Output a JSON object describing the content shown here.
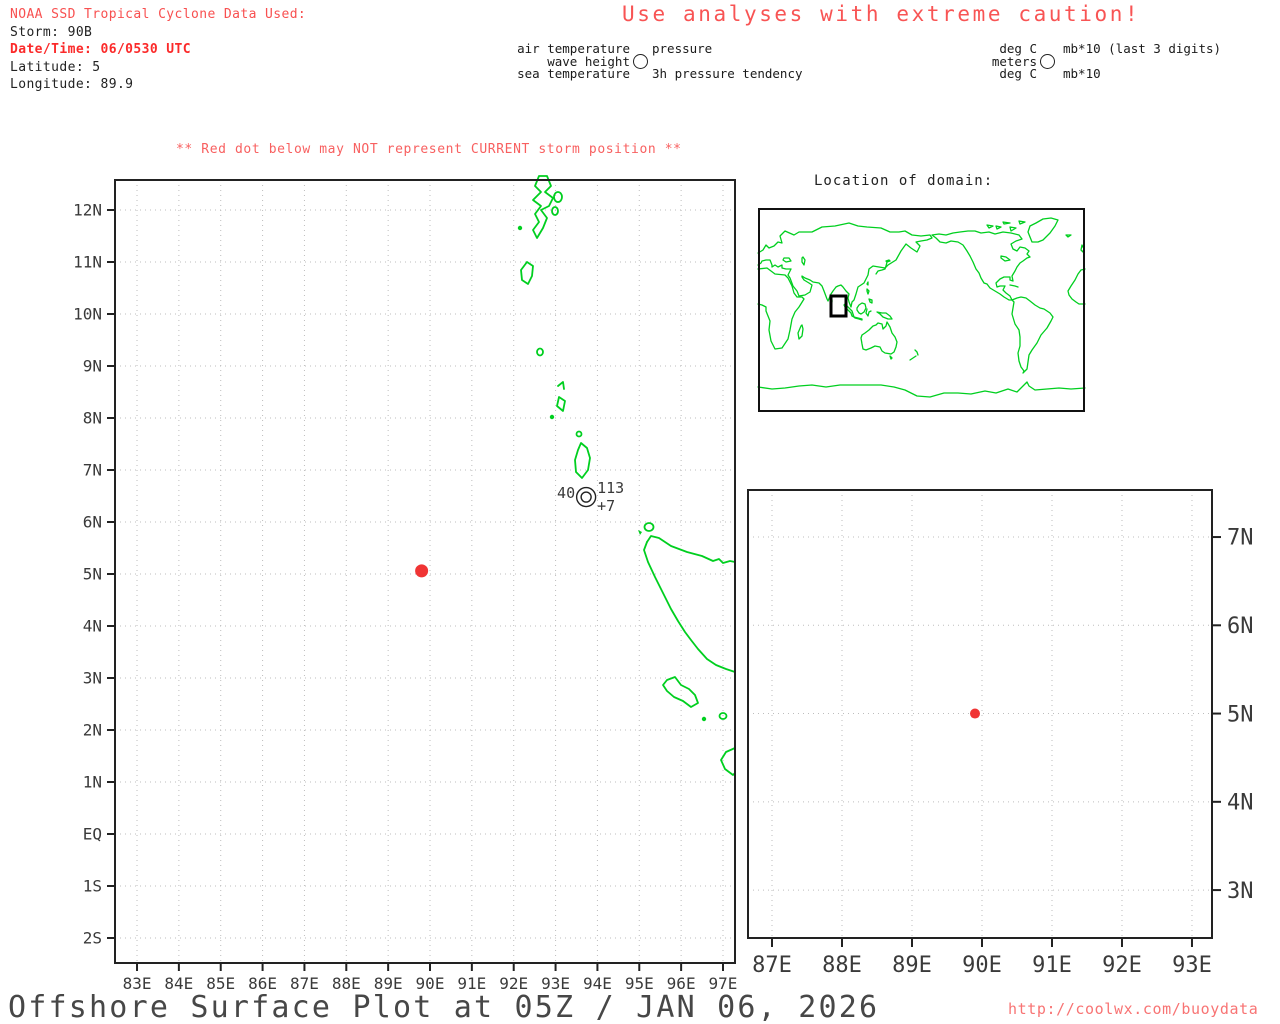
{
  "colors": {
    "red_text": "#f85050",
    "red_bold": "#fb2a2a",
    "green_coast": "#00cf1f",
    "dot_red": "#f03434",
    "grid_gray": "#bdbdbd",
    "axis_text": "#3a3a3a"
  },
  "info_block": {
    "source": "NOAA SSD Tropical Cyclone Data Used:",
    "storm": "Storm: 90B",
    "datetime": "Date/Time: 06/0530 UTC",
    "latitude": "Latitude: 5",
    "longitude": "Longitude: 89.9"
  },
  "caution": "Use analyses with extreme caution!",
  "station_legend": {
    "air": "air temperature",
    "wave": "wave height",
    "sea": "sea temperature",
    "pressure": "pressure",
    "tendency": "3h pressure tendency"
  },
  "units_legend": {
    "air": "deg C",
    "wave": "meters",
    "sea": "deg C",
    "pressure": "mb*10 (last 3 digits)",
    "tendency": "mb*10"
  },
  "warning": "** Red dot below may NOT represent CURRENT storm position **",
  "inset_title": "Location of domain:",
  "footer": {
    "title": "Offshore Surface Plot at 05Z / JAN 06, 2026",
    "url": "http://coolwx.com/buoydata"
  },
  "chart_data": {
    "type": "scatter",
    "title": "Offshore Surface Plot at 05Z / JAN 06, 2026",
    "maps": [
      {
        "id": "main",
        "lon_range": [
          82.5,
          97.3
        ],
        "lat_range": [
          -2.5,
          12.6
        ],
        "x_ticks": [
          {
            "label": "83E",
            "lon": 83
          },
          {
            "label": "84E",
            "lon": 84
          },
          {
            "label": "85E",
            "lon": 85
          },
          {
            "label": "86E",
            "lon": 86
          },
          {
            "label": "87E",
            "lon": 87
          },
          {
            "label": "88E",
            "lon": 88
          },
          {
            "label": "89E",
            "lon": 89
          },
          {
            "label": "90E",
            "lon": 90
          },
          {
            "label": "91E",
            "lon": 91
          },
          {
            "label": "92E",
            "lon": 92
          },
          {
            "label": "93E",
            "lon": 93
          },
          {
            "label": "94E",
            "lon": 94
          },
          {
            "label": "95E",
            "lon": 95
          },
          {
            "label": "96E",
            "lon": 96
          },
          {
            "label": "97E",
            "lon": 97
          }
        ],
        "y_ticks": [
          {
            "label": "12N",
            "lat": 12
          },
          {
            "label": "11N",
            "lat": 11
          },
          {
            "label": "10N",
            "lat": 10
          },
          {
            "label": "9N",
            "lat": 9
          },
          {
            "label": "8N",
            "lat": 8
          },
          {
            "label": "7N",
            "lat": 7
          },
          {
            "label": "6N",
            "lat": 6
          },
          {
            "label": "5N",
            "lat": 5
          },
          {
            "label": "4N",
            "lat": 4
          },
          {
            "label": "3N",
            "lat": 3
          },
          {
            "label": "2N",
            "lat": 2
          },
          {
            "label": "1N",
            "lat": 1
          },
          {
            "label": "EQ",
            "lat": 0
          },
          {
            "label": "1S",
            "lat": -1
          },
          {
            "label": "2S",
            "lat": -2
          }
        ],
        "points": [
          {
            "kind": "storm-position",
            "marker": "red-dot",
            "lon": 89.8,
            "lat": 5.06
          },
          {
            "kind": "ship-observation",
            "marker": "double-circle",
            "lon": 93.73,
            "lat": 6.48,
            "air_temperature": "40",
            "pressure": "113",
            "pressure_tendency": "+7"
          }
        ]
      },
      {
        "id": "zoom",
        "lon_range": [
          86.7,
          93.3
        ],
        "lat_range": [
          2.5,
          7.5
        ],
        "x_ticks": [
          {
            "label": "87E",
            "lon": 87
          },
          {
            "label": "88E",
            "lon": 88
          },
          {
            "label": "89E",
            "lon": 89
          },
          {
            "label": "90E",
            "lon": 90
          },
          {
            "label": "91E",
            "lon": 91
          },
          {
            "label": "92E",
            "lon": 92
          },
          {
            "label": "93E",
            "lon": 93
          }
        ],
        "y_ticks": [
          {
            "label": "7N",
            "lat": 7
          },
          {
            "label": "6N",
            "lat": 6
          },
          {
            "label": "5N",
            "lat": 5
          },
          {
            "label": "4N",
            "lat": 4
          },
          {
            "label": "3N",
            "lat": 3
          }
        ],
        "points": [
          {
            "kind": "storm-position",
            "marker": "red-dot",
            "lon": 89.9,
            "lat": 5.0
          }
        ]
      }
    ]
  }
}
